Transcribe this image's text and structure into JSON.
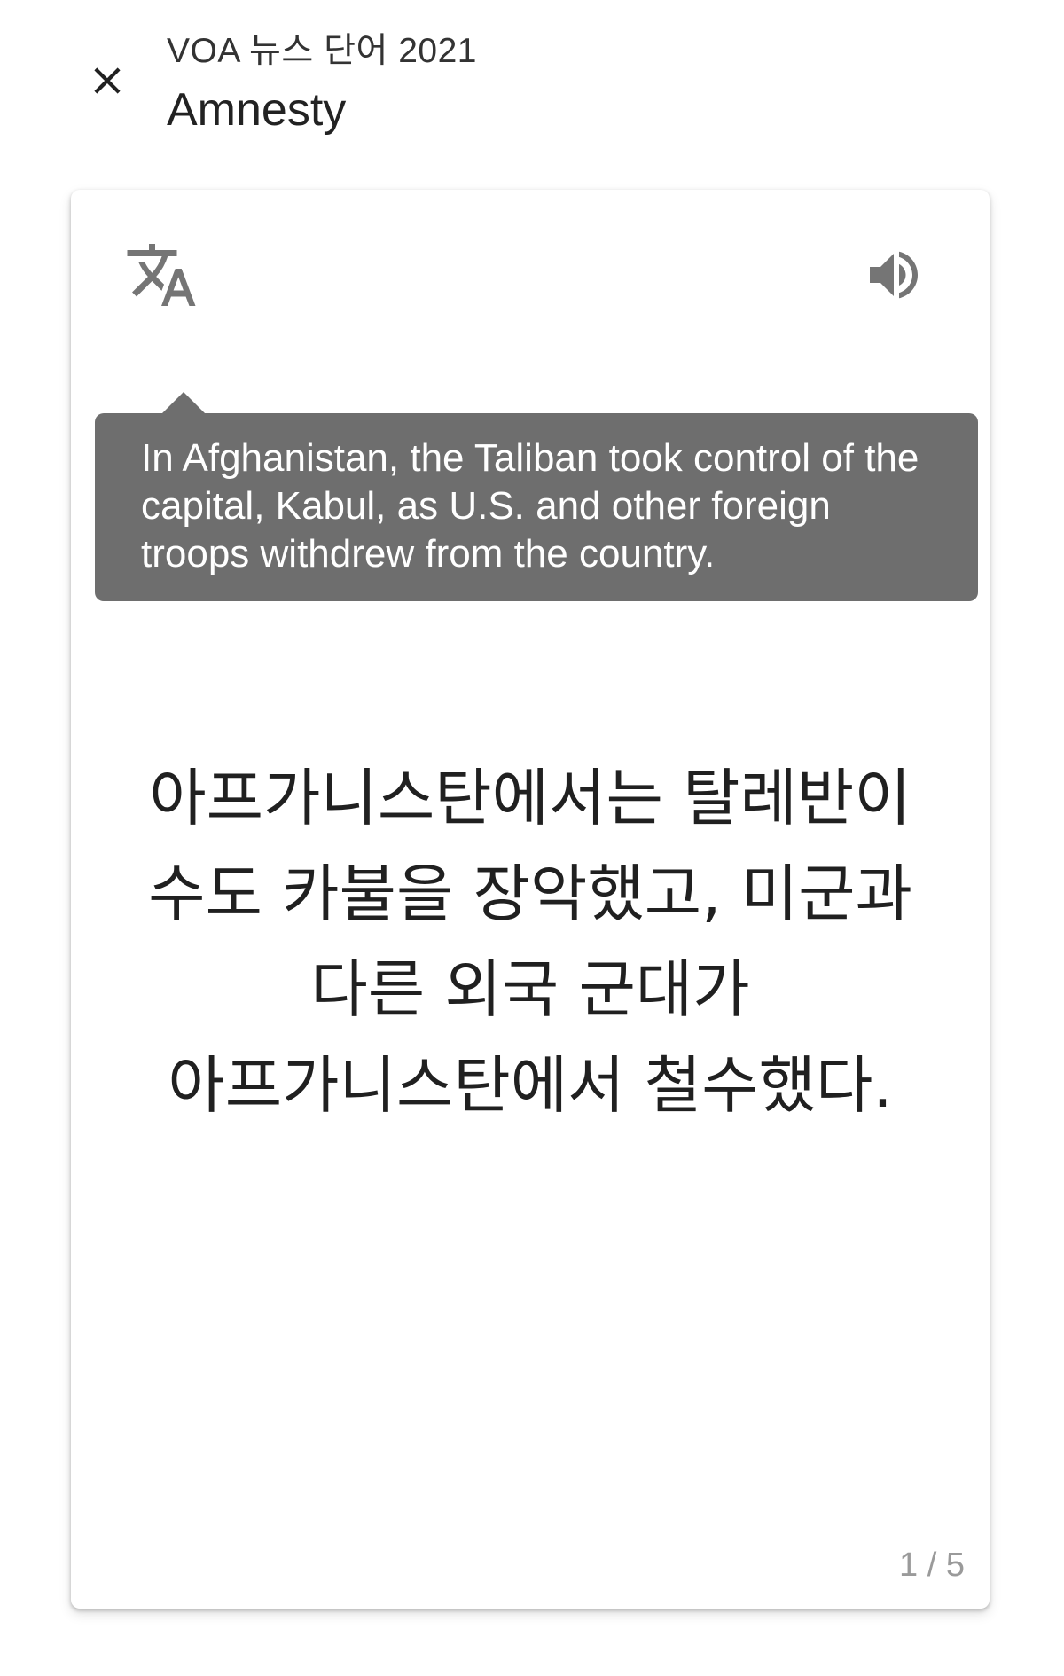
{
  "header": {
    "close_icon": "close-icon",
    "deck_name": "VOA 뉴스 단어 2021",
    "word": "Amnesty"
  },
  "card": {
    "translate_icon": "translate-icon",
    "sound_icon": "volume-up-icon",
    "example_en": "In Afghanistan, the Taliban took control of the capital, Kabul, as U.S. and other foreign troops withdrew from the country.",
    "example_ko": "아프가니스탄에서는 탈레반이 수도 카불을 장악했고, 미군과 다른 외국 군대가 아프가니스탄에서 철수했다.",
    "page_indicator": "1 / 5"
  },
  "colors": {
    "tooltip_background": "#6e6e6e",
    "icon_gray": "#757575",
    "page_indicator": "#9a9a9a"
  }
}
